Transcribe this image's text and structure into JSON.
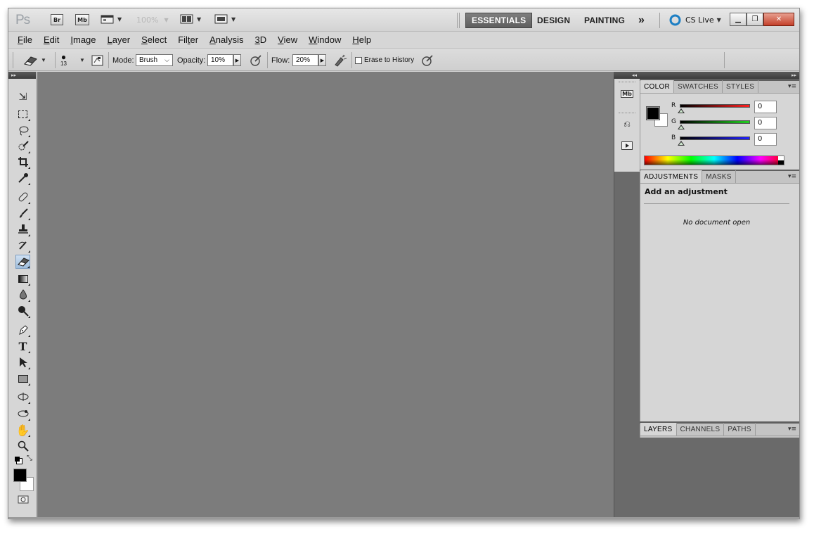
{
  "appbar": {
    "logo": "Ps",
    "bridge_label": "Br",
    "minibridge_label": "Mb",
    "zoom_value": "100%",
    "workspaces": [
      "ESSENTIALS",
      "DESIGN",
      "PAINTING"
    ],
    "more_label": "»",
    "cslive_label": "CS Live"
  },
  "menu": {
    "items": [
      {
        "ul": "F",
        "rest": "ile"
      },
      {
        "ul": "E",
        "rest": "dit"
      },
      {
        "ul": "I",
        "rest": "mage"
      },
      {
        "ul": "L",
        "rest": "ayer"
      },
      {
        "ul": "S",
        "rest": "elect"
      },
      {
        "pre": "Fil",
        "ul": "t",
        "rest": "er"
      },
      {
        "ul": "A",
        "rest": "nalysis"
      },
      {
        "ul": "3",
        "rest": "D"
      },
      {
        "ul": "V",
        "rest": "iew"
      },
      {
        "ul": "W",
        "rest": "indow"
      },
      {
        "ul": "H",
        "rest": "elp"
      }
    ]
  },
  "options": {
    "brush_size": "13",
    "mode_label": "Mode:",
    "mode_value": "Brush",
    "opacity_label": "Opacity:",
    "opacity_value": "10%",
    "flow_label": "Flow:",
    "flow_value": "20%",
    "erase_history_label": "Erase to History",
    "erase_history_checked": false
  },
  "tools": {
    "active": "eraser-tool"
  },
  "color_panel": {
    "tabs": [
      "COLOR",
      "SWATCHES",
      "STYLES"
    ],
    "channels": [
      {
        "label": "R",
        "value": "0",
        "color": "#d42020"
      },
      {
        "label": "G",
        "value": "0",
        "color": "#20b020"
      },
      {
        "label": "B",
        "value": "0",
        "color": "#2020d0"
      }
    ],
    "foreground": "#000000",
    "background": "#ffffff"
  },
  "adjustments_panel": {
    "tabs": [
      "ADJUSTMENTS",
      "MASKS"
    ],
    "heading": "Add an adjustment",
    "empty_message": "No document open"
  },
  "layers_panel": {
    "tabs": [
      "LAYERS",
      "CHANNELS",
      "PATHS"
    ]
  }
}
